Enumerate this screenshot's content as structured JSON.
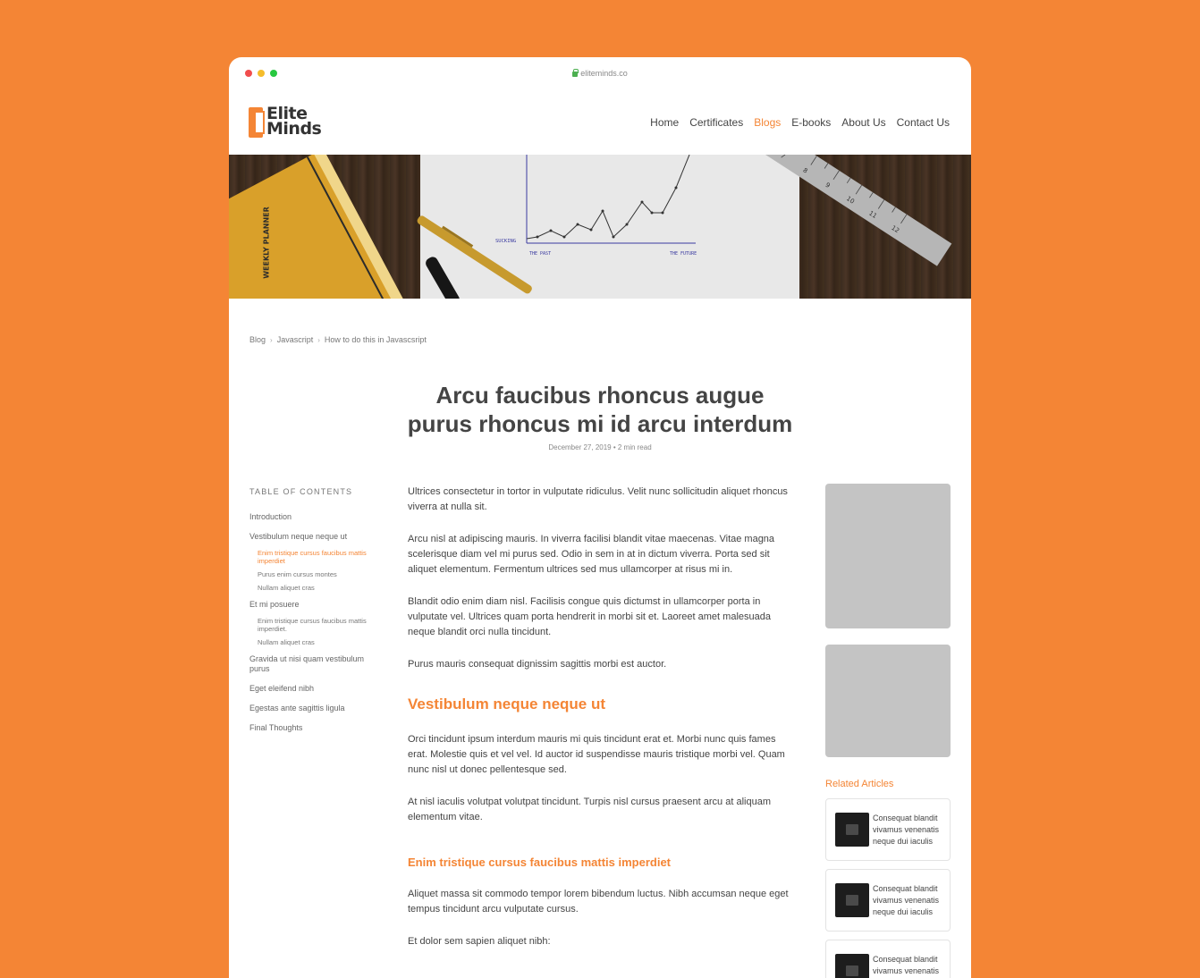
{
  "browser": {
    "url": "eliteminds.co",
    "dots": [
      "#F14D4D",
      "#F5BD2B",
      "#27C840"
    ]
  },
  "brand": {
    "line1": "Elite",
    "line2": "Minds",
    "accent": "#F48535"
  },
  "nav": {
    "items": [
      {
        "label": "Home",
        "active": false
      },
      {
        "label": "Certificates",
        "active": false
      },
      {
        "label": "Blogs",
        "active": true
      },
      {
        "label": "E-books",
        "active": false
      },
      {
        "label": "About Us",
        "active": false
      },
      {
        "label": "Contact Us",
        "active": false
      }
    ]
  },
  "hero": {
    "planner_label": "WEEKLY PLANNER",
    "chart_label_y": "SUCKING",
    "chart_label_past": "THE PAST",
    "chart_label_future": "THE FUTURE",
    "ruler_numbers": [
      "7",
      "8",
      "9",
      "10",
      "11",
      "12"
    ]
  },
  "breadcrumb": [
    "Blog",
    "Javascript",
    "How to do this in Javascsript"
  ],
  "article": {
    "title_line1": "Arcu faucibus rhoncus augue",
    "title_line2": "purus rhoncus mi id arcu interdum",
    "meta": "December 27, 2019 • 2 min read"
  },
  "toc": {
    "heading": "TABLE OF CONTENTS",
    "items": [
      {
        "label": "Introduction"
      },
      {
        "label": "Vestibulum neque neque ut"
      },
      {
        "label": "Enim tristique cursus faucibus mattis imperdiet",
        "active": true
      },
      {
        "label": "Purus enim cursus montes"
      },
      {
        "label": "Nullam aliquet cras"
      },
      {
        "label": "Et mi posuere"
      },
      {
        "label": "Enim tristique cursus faucibus mattis imperdiet."
      },
      {
        "label": "Nullam aliquet cras"
      },
      {
        "label": "Gravida ut nisi quam vestibulum purus"
      },
      {
        "label": "Eget eleifend nibh"
      },
      {
        "label": "Egestas ante sagittis ligula"
      },
      {
        "label": "Final Thoughts"
      }
    ]
  },
  "body": {
    "p1": "Ultrices consectetur in tortor in vulputate ridiculus. Velit nunc sollicitudin aliquet rhoncus viverra at nulla sit.",
    "p2": "Arcu nisl at adipiscing mauris. In viverra facilisi blandit vitae maecenas. Vitae magna scelerisque diam vel mi purus sed. Odio in sem in at in dictum viverra. Porta sed sit aliquet elementum. Fermentum ultrices sed mus ullamcorper at risus mi in.",
    "p3": "Blandit odio enim diam nisl. Facilisis congue quis dictumst in ullamcorper porta in vulputate vel. Ultrices quam porta hendrerit in morbi sit et. Laoreet amet malesuada neque blandit orci nulla tincidunt.",
    "p4": "Purus mauris consequat dignissim sagittis morbi est auctor.",
    "h2": "Vestibulum neque neque ut",
    "p5": "Orci tincidunt ipsum interdum mauris mi quis tincidunt erat et. Morbi nunc quis fames erat. Molestie quis et vel vel. Id auctor id suspendisse mauris tristique morbi vel. Quam nunc nisl ut donec pellentesque sed.",
    "p6": "At nisl iaculis volutpat volutpat tincidunt. Turpis nisl cursus praesent arcu at aliquam elementum vitae.",
    "h3": "Enim tristique cursus faucibus mattis imperdiet",
    "p7": "Aliquet massa sit commodo tempor lorem bibendum luctus. Nibh accumsan neque eget tempus tincidunt arcu vulputate cursus.",
    "p8": "Et dolor sem sapien aliquet nibh:"
  },
  "sidebar": {
    "related_title": "Related Articles",
    "related": [
      {
        "title": "Consequat blandit vivamus venenatis neque dui iaculis"
      },
      {
        "title": "Consequat blandit vivamus venenatis neque dui iaculis"
      },
      {
        "title": "Consequat blandit vivamus venenatis neque dui iaculis"
      }
    ]
  }
}
